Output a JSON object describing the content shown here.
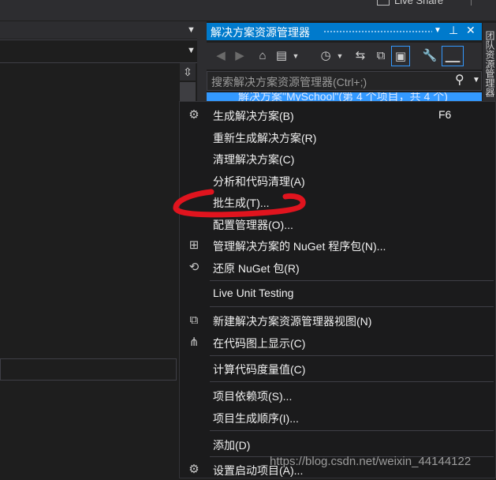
{
  "top": {
    "share_label": "Live Share"
  },
  "solution_explorer": {
    "title": "解决方案资源管理器",
    "search_placeholder": "搜索解决方案资源管理器(Ctrl+;)",
    "solution_row": "解决方案\"MySchool\"(第 4 个项目，共 4 个)",
    "side_tab": "团队资源管理器"
  },
  "context_menu": {
    "items": [
      {
        "label": "生成解决方案(B)",
        "shortcut": "F6",
        "icon": "build-icon"
      },
      {
        "label": "重新生成解决方案(R)"
      },
      {
        "label": "清理解决方案(C)"
      },
      {
        "label": "分析和代码清理(A)"
      },
      {
        "label": "批生成(T)..."
      },
      {
        "label": "配置管理器(O)..."
      },
      {
        "label": "管理解决方案的 NuGet 程序包(N)...",
        "icon": "nuget-icon"
      },
      {
        "label": "还原 NuGet 包(R)",
        "icon": "restore-icon"
      },
      {
        "label": "Live Unit Testing"
      },
      {
        "label": "新建解决方案资源管理器视图(N)",
        "icon": "new-view-icon"
      },
      {
        "label": "在代码图上显示(C)",
        "icon": "code-map-icon"
      },
      {
        "label": "计算代码度量值(C)"
      },
      {
        "label": "项目依赖项(S)..."
      },
      {
        "label": "项目生成顺序(I)..."
      },
      {
        "label": "添加(D)"
      },
      {
        "label": "设置启动项目(A)...",
        "icon": "gear-icon"
      }
    ]
  },
  "watermark": "https://blog.csdn.net/weixin_44144122",
  "colors": {
    "accent": "#007acc",
    "annotation": "#e0141e"
  }
}
